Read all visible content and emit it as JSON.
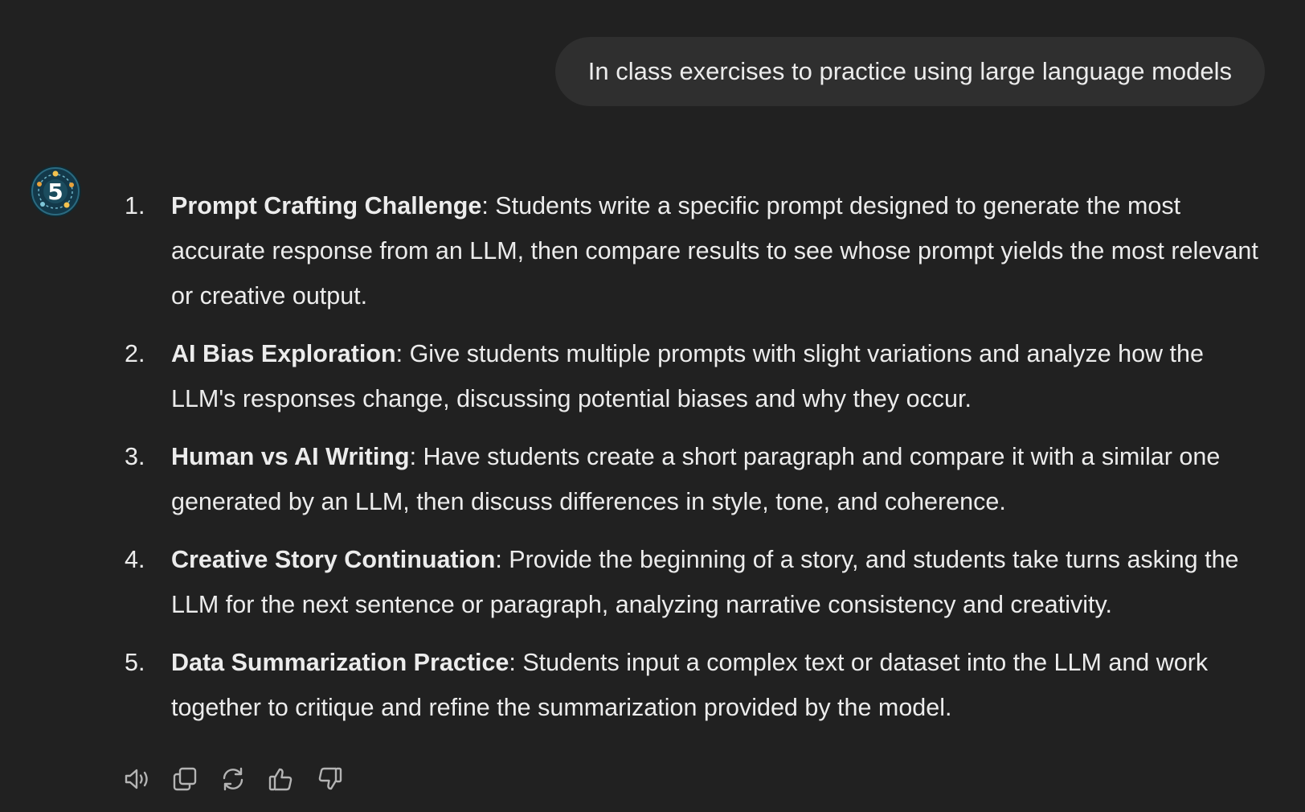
{
  "user_message": "In class exercises to practice using large language models",
  "assistant": {
    "avatar_icon": "gpt-avatar-number-5",
    "items": [
      {
        "number": "1.",
        "title": "Prompt Crafting Challenge",
        "text": ": Students write a specific prompt designed to generate the most accurate response from an LLM, then compare results to see whose prompt yields the most relevant or creative output."
      },
      {
        "number": "2.",
        "title": "AI Bias Exploration",
        "text": ": Give students multiple prompts with slight variations and analyze how the LLM's responses change, discussing potential biases and why they occur."
      },
      {
        "number": "3.",
        "title": "Human vs AI Writing",
        "text": ": Have students create a short paragraph and compare it with a similar one generated by an LLM, then discuss differences in style, tone, and coherence."
      },
      {
        "number": "4.",
        "title": "Creative Story Continuation",
        "text": ": Provide the beginning of a story, and students take turns asking the LLM for the next sentence or paragraph, analyzing narrative consistency and creativity."
      },
      {
        "number": "5.",
        "title": "Data Summarization Practice",
        "text": ": Students input a complex text or dataset into the LLM and work together to critique and refine the summarization provided by the model."
      }
    ]
  },
  "action_bar": [
    {
      "icon": "speaker-icon"
    },
    {
      "icon": "copy-icon"
    },
    {
      "icon": "regenerate-icon"
    },
    {
      "icon": "thumbs-up-icon"
    },
    {
      "icon": "thumbs-down-icon"
    }
  ],
  "colors": {
    "background": "#212121",
    "user_bubble": "#2f2f2f",
    "text": "#ececec",
    "icon": "#b4b4b4"
  }
}
